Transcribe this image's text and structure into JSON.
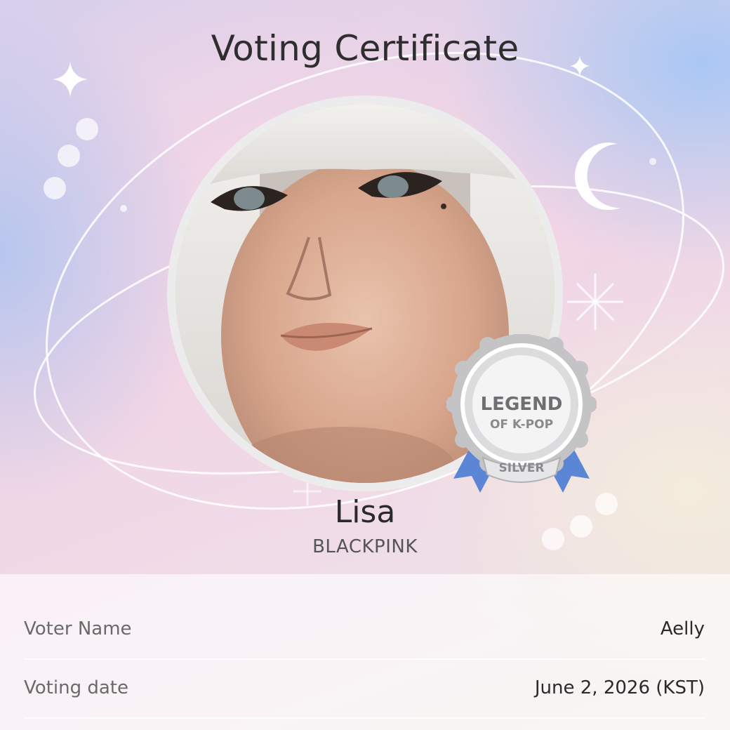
{
  "title": "Voting Certificate",
  "artist": {
    "name": "Lisa",
    "group": "BLACKPINK"
  },
  "badge": {
    "line1": "LEGEND",
    "line2": "OF K-POP",
    "tier": "SILVER"
  },
  "details": [
    {
      "label": "Voter Name",
      "value": "Aelly"
    },
    {
      "label": "Voting date",
      "value": "June 2, 2026 (KST)"
    }
  ],
  "colors": {
    "ribbon": "#5b86d6",
    "medal": "#c8c8ca",
    "title": "#2e2e2e"
  },
  "icons": [
    "sparkle-icon",
    "crescent-moon-icon",
    "star-burst-icon",
    "medal-badge-icon"
  ]
}
